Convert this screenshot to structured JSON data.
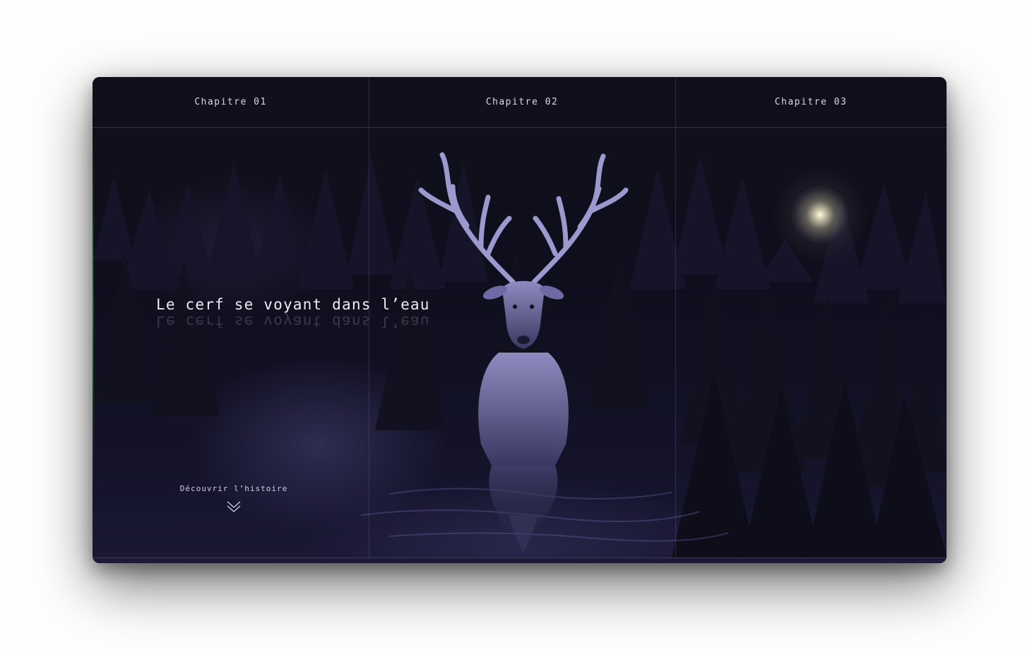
{
  "nav": {
    "items": [
      {
        "label": "Chapitre 01"
      },
      {
        "label": "Chapitre 02"
      },
      {
        "label": "Chapitre 03"
      }
    ]
  },
  "hero": {
    "title": "Le cerf se voyant dans l’eau",
    "cta_label": "Découvrir l’histoire",
    "cta_icon": "double-chevron-down-icon"
  },
  "illustrations": {
    "center": "stag-icon",
    "right": "moon-icon"
  },
  "colors": {
    "background": "#0d0c18",
    "text": "#ecebf6",
    "accent": "#8a86c8"
  }
}
